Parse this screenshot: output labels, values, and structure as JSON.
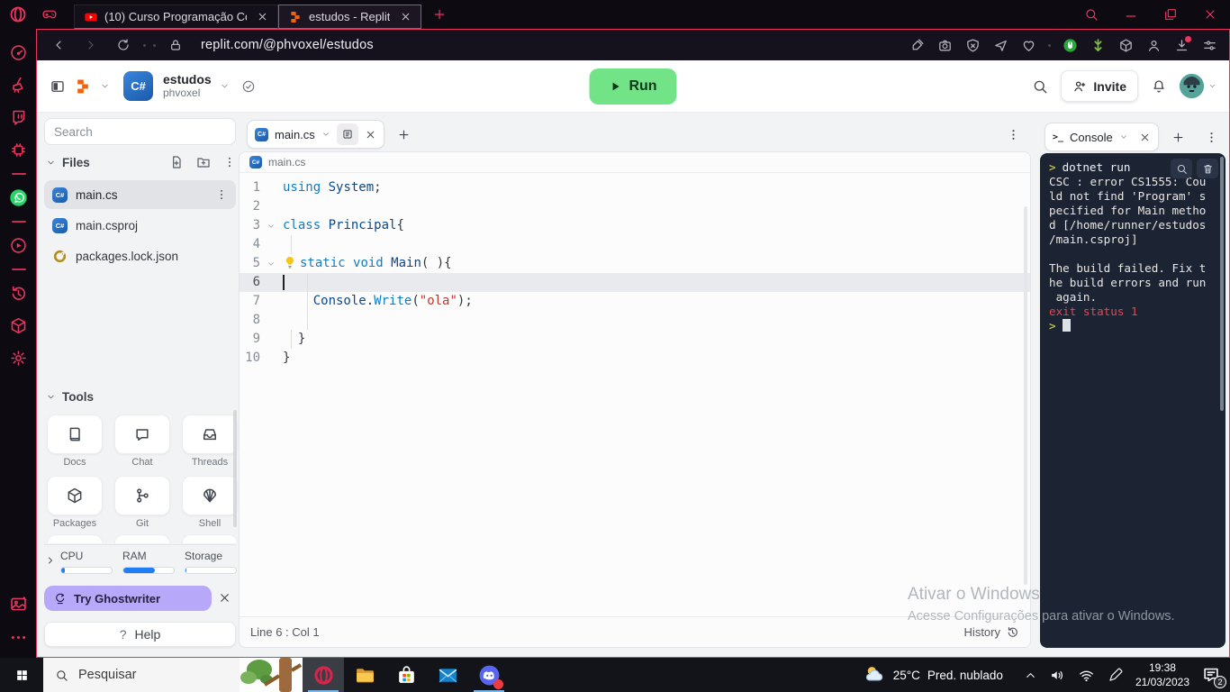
{
  "colors": {
    "accent": "#e8365f",
    "run_green": "#72e386",
    "ghostwriter_purple": "#b7a8f9",
    "ram_blue": "#1f7ff2",
    "console_bg": "#1c2333",
    "error_red": "#e5484d",
    "prompt_yellow": "#b5bd45",
    "csharp_blue": "#2a6fd1",
    "folder_yellow": "#f7c94e"
  },
  "browser": {
    "tabs": [
      {
        "title": "(10) Curso Programação Co",
        "favicon": "youtube-icon",
        "active": false
      },
      {
        "title": "estudos - Replit",
        "favicon": "replit-icon",
        "active": true
      }
    ],
    "url": "replit.com/@phvoxel/estudos",
    "toolbar_icons": [
      "pin-edit-icon",
      "camera-icon",
      "shield-off-icon",
      "send-icon",
      "heart-icon",
      "sep",
      "mouse-extension-icon",
      "boost-extension-icon",
      "cube-icon",
      "profile-icon",
      "download-icon",
      "tune-icon"
    ]
  },
  "opera_sidebar": {
    "top": [
      "speed-dial-icon",
      "cleaner-icon",
      "twitch-icon",
      "gx-control-icon",
      "sep",
      "whatsapp-icon",
      "sep",
      "player-icon",
      "sep",
      "history-icon",
      "extensions-icon",
      "settings-icon"
    ],
    "bottom": [
      "snapshot-icon",
      "more-icon"
    ]
  },
  "glyphs": {
    "terminal": ">_",
    "question": "?",
    "csharp": "C#"
  },
  "replit": {
    "header": {
      "project": "estudos",
      "owner": "phvoxel",
      "run_label": "Run",
      "invite_label": "Invite"
    },
    "panel": {
      "search_placeholder": "Search",
      "files_title": "Files",
      "files": [
        {
          "name": "main.cs",
          "icon": "csharp-icon",
          "selected": true
        },
        {
          "name": "main.csproj",
          "icon": "csharp-icon",
          "selected": false
        },
        {
          "name": "packages.lock.json",
          "icon": "json-icon",
          "selected": false
        }
      ],
      "tools_title": "Tools",
      "tools": [
        {
          "label": "Docs",
          "icon": "docs-icon"
        },
        {
          "label": "Chat",
          "icon": "chat-icon"
        },
        {
          "label": "Threads",
          "icon": "threads-icon"
        },
        {
          "label": "Packages",
          "icon": "packages-icon"
        },
        {
          "label": "Git",
          "icon": "git-icon"
        },
        {
          "label": "Shell",
          "icon": "shell-icon"
        }
      ],
      "meters": [
        {
          "label": "CPU",
          "percent": 7
        },
        {
          "label": "RAM",
          "percent": 62
        },
        {
          "label": "Storage",
          "percent": 1
        }
      ],
      "ghostwriter_label": "Try Ghostwriter",
      "help_label": "Help"
    },
    "editor": {
      "tab_label": "main.cs",
      "breadcrumb": "main.cs",
      "status_left": "Line 6 : Col 1",
      "history_label": "History",
      "code": [
        {
          "n": "1",
          "tokens": [
            [
              "k",
              "using"
            ],
            [
              "p",
              " "
            ],
            [
              "t",
              "System"
            ],
            [
              "p",
              ";"
            ]
          ]
        },
        {
          "n": "2",
          "tokens": []
        },
        {
          "n": "3",
          "fold": true,
          "tokens": [
            [
              "k",
              "class"
            ],
            [
              "p",
              " "
            ],
            [
              "t",
              "Principal"
            ],
            [
              "p",
              "{"
            ]
          ]
        },
        {
          "n": "4",
          "tokens": [],
          "guides": [
            9
          ]
        },
        {
          "n": "5",
          "fold": true,
          "bulb": true,
          "tokens": [
            [
              "k",
              "static"
            ],
            [
              "p",
              " "
            ],
            [
              "k",
              "void"
            ],
            [
              "p",
              " "
            ],
            [
              "t",
              "Main"
            ],
            [
              "p",
              "( ){"
            ]
          ]
        },
        {
          "n": "6",
          "highlight": true,
          "cursor": true,
          "tokens": [],
          "guides": [
            27
          ]
        },
        {
          "n": "7",
          "tokens": [
            [
              "p",
              "    "
            ],
            [
              "t",
              "Console"
            ],
            [
              "p",
              "."
            ],
            [
              "m",
              "Write"
            ],
            [
              "p",
              "("
            ],
            [
              "s",
              "\"ola\""
            ],
            [
              "p",
              ");"
            ]
          ],
          "guides": [
            27
          ]
        },
        {
          "n": "8",
          "tokens": [],
          "guides": [
            27
          ]
        },
        {
          "n": "9",
          "tokens": [
            [
              "p",
              "  }"
            ]
          ],
          "guides": [
            9
          ]
        },
        {
          "n": "10",
          "tokens": [
            [
              "p",
              "}"
            ]
          ]
        }
      ]
    },
    "console": {
      "tab_label": "Console",
      "prompt_symbol": ">",
      "lines": [
        {
          "kind": "command",
          "text": "dotnet run"
        },
        {
          "kind": "error",
          "text": "CSC : error CS1555: Cou"
        },
        {
          "kind": "error",
          "text": "ld not find 'Program' s"
        },
        {
          "kind": "error",
          "text": "pecified for Main metho"
        },
        {
          "kind": "error",
          "text": "d [/home/runner/estudos"
        },
        {
          "kind": "error",
          "text": "/main.csproj]"
        },
        {
          "kind": "blank",
          "text": ""
        },
        {
          "kind": "error",
          "text": "The build failed. Fix t"
        },
        {
          "kind": "error",
          "text": "he build errors and run"
        },
        {
          "kind": "error",
          "text": " again."
        },
        {
          "kind": "exit",
          "text": "exit status 1"
        },
        {
          "kind": "prompt",
          "text": ""
        }
      ]
    }
  },
  "watermark": {
    "line1": "Ativar o Windows",
    "line2": "Acesse Configurações para ativar o Windows."
  },
  "taskbar": {
    "search_placeholder": "Pesquisar",
    "apps": [
      {
        "name": "opera",
        "icon": "opera-icon",
        "focused": true,
        "running": true
      },
      {
        "name": "explorer",
        "icon": "explorer-icon",
        "focused": false,
        "running": false
      },
      {
        "name": "store",
        "icon": "store-icon",
        "focused": false,
        "running": false
      },
      {
        "name": "mail",
        "icon": "mail-icon",
        "focused": false,
        "running": false
      },
      {
        "name": "discord",
        "icon": "discord-icon",
        "focused": false,
        "running": true,
        "badge": true
      }
    ],
    "weather_temp": "25°C",
    "weather_desc": "Pred. nublado",
    "time": "19:38",
    "date": "21/03/2023",
    "notification_count": "2"
  }
}
